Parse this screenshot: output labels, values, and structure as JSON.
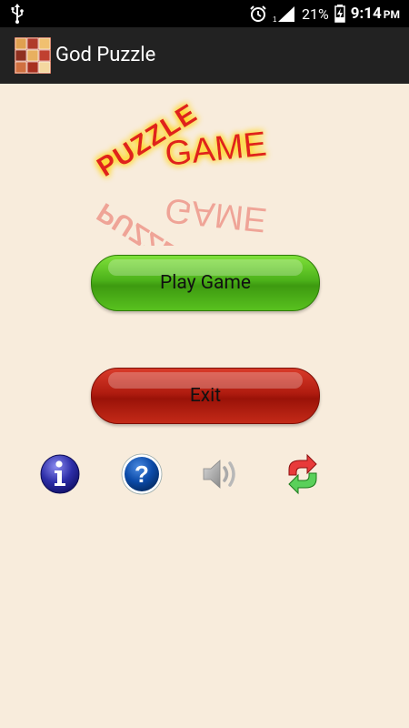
{
  "status_bar": {
    "usb_icon": "usb-icon",
    "alarm_icon": "alarm-icon",
    "signal_icon": "signal-icon",
    "battery_percent": "21%",
    "battery_icon": "battery-charging-icon",
    "time": "9:14",
    "meridiem": "PM"
  },
  "action_bar": {
    "title": "God Puzzle",
    "app_icon": "app-icon"
  },
  "logo": {
    "word1": "PUZZLE",
    "word2": "GAME"
  },
  "buttons": {
    "play": "Play Game",
    "exit": "Exit"
  },
  "icons": [
    "info-icon",
    "help-icon",
    "sound-icon",
    "refresh-icon"
  ],
  "colors": {
    "background": "#f8ecdc",
    "play_green": "#4cb21a",
    "exit_red": "#b01c10",
    "logo_red": "#e0221a",
    "logo_glow": "#ffd200"
  }
}
